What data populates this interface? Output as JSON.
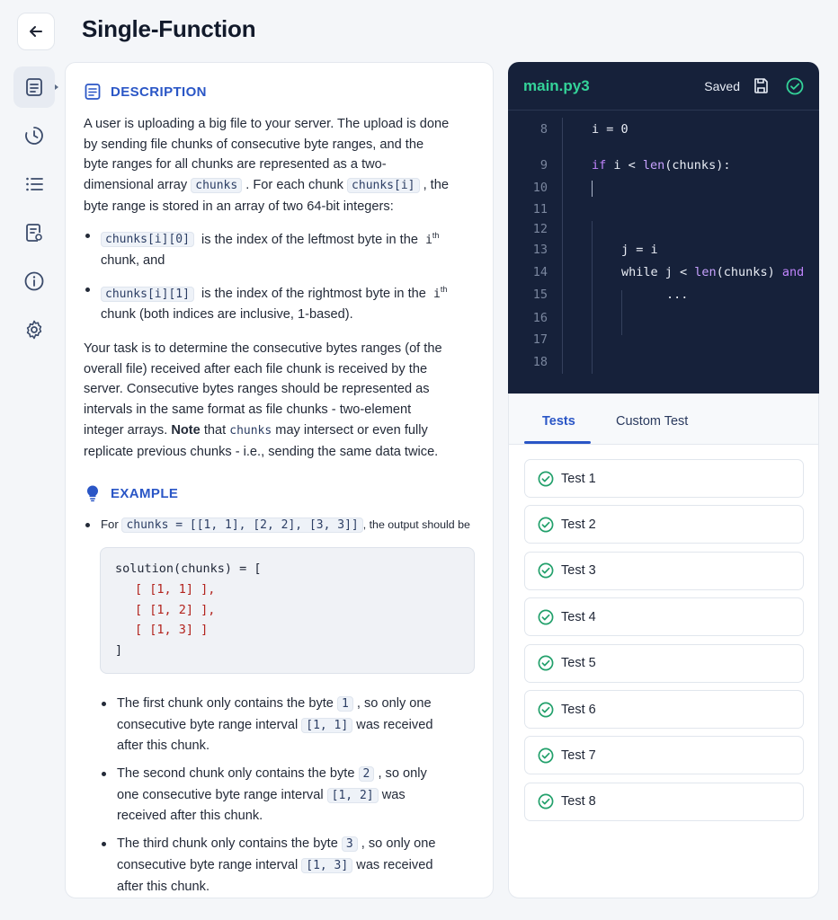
{
  "header": {
    "title": "Single-Function"
  },
  "description": {
    "heading": "DESCRIPTION",
    "p1_a": "A user is uploading a big file to your server. The upload is done",
    "p1_b": "by sending file chunks of consecutive byte ranges, and the",
    "p1_c": "byte ranges for all chunks are represented as a two-",
    "p1_d1": "dimensional array",
    "p1_code1": "chunks",
    "p1_d2": ". For each chunk",
    "p1_code2": "chunks[i]",
    "p1_d3": ", the",
    "p1_e": "byte range is stored in an array of two 64-bit integers:",
    "b1_code": "chunks[i][0]",
    "b1_text": "is the index of the leftmost byte in the",
    "b1_i": "i",
    "b1_sup": "th",
    "b1_text2": "chunk, and",
    "b2_code": "chunks[i][1]",
    "b2_text": "is the index of the rightmost byte in the",
    "b2_i": "i",
    "b2_sup": "th",
    "b2_text2": "chunk (both indices are inclusive, 1-based).",
    "p2_a": "Your task is to determine the consecutive bytes ranges (of the",
    "p2_b": "overall file) received after each file chunk is received by the",
    "p2_c": "server. Consecutive bytes ranges should be represented as",
    "p2_d": "intervals in the same format as file chunks - two-element",
    "p2_e1": "integer arrays.",
    "p2_note": "Note",
    "p2_e2": "that",
    "p2_code": "chunks",
    "p2_e3": "may intersect or even fully",
    "p2_f": "replicate previous chunks - i.e., sending the same data twice."
  },
  "example": {
    "heading": "EXAMPLE",
    "for_label": "For",
    "for_code": "chunks = [[1, 1], [2, 2], [3, 3]]",
    "for_tail": ", the output should be",
    "code_lines": [
      "solution(chunks) = [",
      "[ [1, 1] ],",
      "[ [1, 2] ],",
      "[ [1, 3] ]",
      "]"
    ],
    "e1_a": "The first chunk only contains the byte",
    "e1_code1": "1",
    "e1_b": ", so only one",
    "e1_c": "consecutive byte range interval",
    "e1_code2": "[1, 1]",
    "e1_d": "was received",
    "e1_e": "after this chunk.",
    "e2_a": "The second chunk only contains the byte",
    "e2_code1": "2",
    "e2_b": ", so only",
    "e2_c": "one consecutive byte range interval",
    "e2_code2": "[1, 2]",
    "e2_d": "was",
    "e2_e": "received after this chunk.",
    "e3_a": "The third chunk only contains the byte",
    "e3_code1": "3",
    "e3_b": ", so only one",
    "e3_c": "consecutive byte range interval",
    "e3_code2": "[1, 3]",
    "e3_d": "was received",
    "e3_e": "after this chunk."
  },
  "editor": {
    "filename": "main.py3",
    "status": "Saved",
    "lines": [
      {
        "n": "8",
        "t": "i = 0"
      },
      {
        "n": "9",
        "kw": "if",
        "t": " i < ",
        "fn": "len",
        "t2": "(chunks):"
      },
      {
        "n": "10",
        "t": ""
      },
      {
        "n": "11",
        "t": ""
      },
      {
        "n": "12",
        "t": ""
      },
      {
        "n": "13",
        "t": "j = i"
      },
      {
        "n": "14",
        "t": "while j < ",
        "fn": "len",
        "t2": "(chunks) ",
        "kw2": "and"
      },
      {
        "n": "15",
        "t": "..."
      },
      {
        "n": "16",
        "t": ""
      },
      {
        "n": "17",
        "t": ""
      },
      {
        "n": "18",
        "t": ""
      }
    ]
  },
  "tests": {
    "tab_tests": "Tests",
    "tab_custom": "Custom Test",
    "items": [
      "Test 1",
      "Test 2",
      "Test 3",
      "Test 4",
      "Test 5",
      "Test 6",
      "Test 7",
      "Test 8"
    ],
    "pass_color": "#22a06b"
  },
  "sidebar_icons": [
    "description-icon",
    "history-icon",
    "list-icon",
    "notes-icon",
    "info-icon",
    "settings-icon"
  ]
}
